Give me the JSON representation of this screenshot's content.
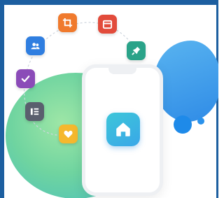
{
  "scene": {
    "colors": {
      "frame": "#1d5fa0",
      "green_blob": "#6fd4a0",
      "blue_blob": "#2f8be6",
      "phone_body": "#ffffff",
      "home_app": "#3aa7e8"
    }
  },
  "app_icons": [
    {
      "icon": "crop-icon",
      "color": "#f07a2d"
    },
    {
      "icon": "calendar-icon",
      "color": "#e24b3b"
    },
    {
      "icon": "pin-icon",
      "color": "#2aa389"
    },
    {
      "icon": "users-icon",
      "color": "#2f7ee0"
    },
    {
      "icon": "check-icon",
      "color": "#8b4bb8"
    },
    {
      "icon": "list-icon",
      "color": "#5a5f6e"
    },
    {
      "icon": "heart-icon",
      "color": "#f5b82e"
    }
  ],
  "phone": {
    "center_app_icon": "home-icon"
  }
}
